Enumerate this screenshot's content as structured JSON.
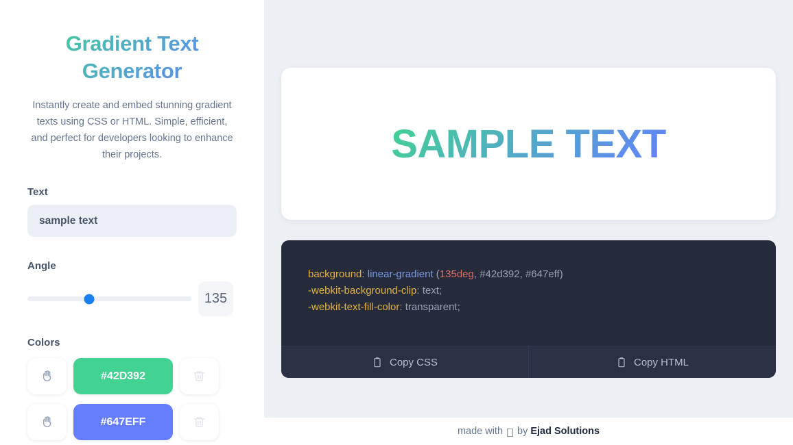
{
  "sidebar": {
    "title": "Gradient Text Generator",
    "subtitle": "Instantly create and embed stunning gradient texts using CSS or HTML. Simple, efficient, and perfect for developers looking to enhance their projects.",
    "text_label": "Text",
    "text_value": "sample text",
    "text_placeholder": "sample text",
    "angle_label": "Angle",
    "angle_value": "135",
    "angle_min": 0,
    "angle_max": 360,
    "angle_percent": 37.5,
    "colors_label": "Colors",
    "colors": [
      {
        "hex": "#42D392",
        "drag_icon": "hand-icon",
        "delete_icon": "trash-icon"
      },
      {
        "hex": "#647EFF",
        "drag_icon": "hand-icon",
        "delete_icon": "trash-icon"
      }
    ]
  },
  "preview": {
    "text": "SAMPLE TEXT",
    "gradient_start": "#42d392",
    "gradient_end": "#647eff",
    "gradient_angle": "135deg"
  },
  "code": {
    "line1_prop": "background",
    "line1_fn": "linear-gradient",
    "line1_angle": "135deg",
    "line1_colors": ", #42d392, #647eff)",
    "line1_open": " (",
    "line2_prop": "-webkit-background-clip",
    "line2_value": "text;",
    "line3_prop": "-webkit-text-fill-color",
    "line3_value": "transparent;",
    "copy_css_label": "Copy CSS",
    "copy_html_label": "Copy HTML"
  },
  "footer": {
    "prefix": "made with",
    "middle": "by",
    "brand": "Ejad Solutions"
  }
}
